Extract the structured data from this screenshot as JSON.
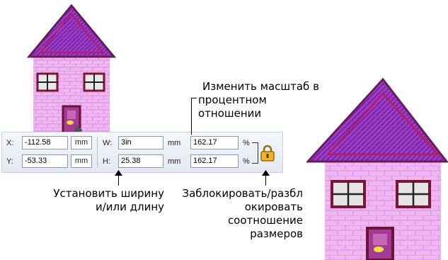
{
  "toolbar": {
    "x_label": "X:",
    "x_value": "-112.58",
    "x_unit": "mm",
    "y_label": "Y:",
    "y_value": "-53.33",
    "y_unit": "mm",
    "w_label": "W:",
    "w_value": "3in",
    "w_unit": "mm",
    "h_label": "H:",
    "h_value": "25.38",
    "h_unit": "mm",
    "w_percent": "162.17",
    "h_percent": "162.17",
    "percent_sign_1": "%",
    "percent_sign_2": "%"
  },
  "annotations": {
    "scale_line1": "Изменить масштаб в",
    "scale_line2": "процентном",
    "scale_line3": "отношении",
    "size_line1": "Установить ширину",
    "size_line2": "и/или длину",
    "lock_line1": "Заблокировать/разбл",
    "lock_line2": "окировать",
    "lock_line3": "соотношение",
    "lock_line4": "размеров"
  },
  "icons": {
    "lock": "lock-icon",
    "house_small": "house-small-image",
    "house_large": "house-large-image"
  },
  "colors": {
    "roof": "#8a2fb3",
    "wall": "#efb3f0",
    "toolbar_bg": "#eceff5",
    "lock_gold": "#e9a823"
  }
}
